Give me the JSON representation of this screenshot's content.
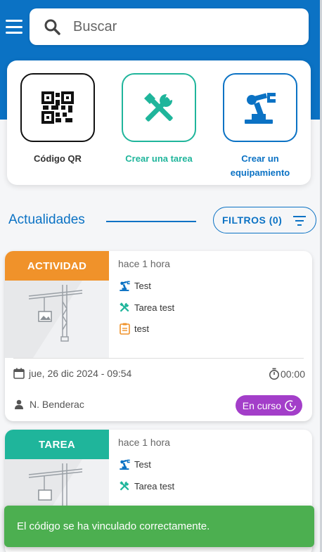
{
  "search": {
    "placeholder": "Buscar"
  },
  "actions": {
    "qr_label": "Código QR",
    "task_label": "Crear una tarea",
    "equipment_label_line1": "Crear un",
    "equipment_label_line2": "equipamiento"
  },
  "news": {
    "title": "Actualidades",
    "filter_label": "FILTROS (0)"
  },
  "cards": [
    {
      "badge": "ACTIVIDAD",
      "time_ago": "hace 1 hora",
      "equipment": "Test",
      "task": "Tarea test",
      "note": "test",
      "date": "jue, 26 dic 2024 - 09:54",
      "duration": "00:00",
      "person": "N. Benderac",
      "status": "En curso"
    },
    {
      "badge": "TAREA",
      "time_ago": "hace 1 hora",
      "equipment": "Test",
      "task": "Tarea test"
    }
  ],
  "toast": {
    "message": "El código se ha vinculado correctamente."
  },
  "colors": {
    "primary": "#0b72c4",
    "task_green": "#1fb59b",
    "activity_orange": "#f0922a",
    "status_purple": "#a33ec9",
    "toast_green": "#4caf50"
  },
  "icons": [
    "menu-icon",
    "search-icon",
    "qr-code-icon",
    "tools-icon",
    "crane-robot-icon",
    "filter-icon",
    "calendar-icon",
    "timer-icon",
    "person-icon",
    "clock-history-icon",
    "clipboard-icon",
    "image-placeholder-icon"
  ]
}
